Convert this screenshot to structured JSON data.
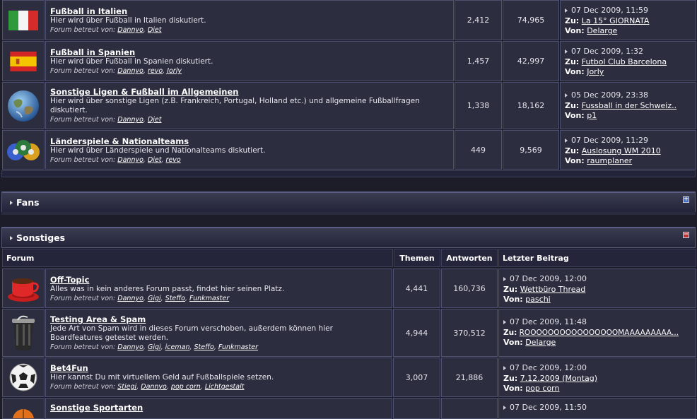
{
  "section_top": {
    "forums": [
      {
        "title": "Fußball in Italien",
        "description": "Hier wird über Fußball in Italien diskutiert.",
        "mods_label": "Forum betreut von:",
        "mods": [
          "Dannyo",
          "Djet"
        ],
        "topics": "2,412",
        "posts": "74,965",
        "last_date": "07 Dec 2009, 11:59",
        "last_to_label": "Zu:",
        "last_thread": "La 15° GIORNATA",
        "last_by_label": "Von:",
        "last_user": "Delarge",
        "icon": "flag-italy-icon"
      },
      {
        "title": "Fußball in Spanien",
        "description": "Hier wird über Fußball in Spanien diskutiert.",
        "mods_label": "Forum betreut von:",
        "mods": [
          "Dannyo",
          "revo",
          "Jorly"
        ],
        "topics": "1,457",
        "posts": "42,997",
        "last_date": "07 Dec 2009, 1:32",
        "last_to_label": "Zu:",
        "last_thread": "Futbol Club Barcelona",
        "last_by_label": "Von:",
        "last_user": "Jorly",
        "icon": "flag-spain-icon"
      },
      {
        "title": "Sonstige Ligen & Fußball im Allgemeinen",
        "description": "Hier wird über sonstige Ligen (z.B. Frankreich, Portugal, Holland etc.) und allgemeine Fußballfragen diskutiert.",
        "mods_label": "Forum betreut von:",
        "mods": [
          "Dannyo",
          "Djet"
        ],
        "topics": "1,338",
        "posts": "18,162",
        "last_date": "05 Dec 2009, 23:38",
        "last_to_label": "Zu:",
        "last_thread": "Fussball in der Schweiz..",
        "last_by_label": "Von:",
        "last_user": "p1",
        "icon": "globe-icon"
      },
      {
        "title": "Länderspiele & Nationalteams",
        "description": "Hier wird über Länderspiele und Nationalteams diskutiert.",
        "mods_label": "Forum betreut von:",
        "mods": [
          "Dannyo",
          "Djet",
          "revo"
        ],
        "topics": "449",
        "posts": "9,569",
        "last_date": "07 Dec 2009, 11:29",
        "last_to_label": "Zu:",
        "last_thread": "Auslosung WM 2010",
        "last_by_label": "Von:",
        "last_user": "raumplaner",
        "icon": "soccer-balls-icon"
      }
    ]
  },
  "category_fans": {
    "label": "Fans",
    "toggle": "+"
  },
  "category_sonstiges": {
    "label": "Sonstiges",
    "toggle": "−",
    "columns": {
      "forum": "Forum",
      "topics": "Themen",
      "posts": "Antworten",
      "last": "Letzter Beitrag"
    },
    "forums": [
      {
        "title": "Off-Topic",
        "description": "Alles was in kein anderes Forum passt, findet hier seinen Platz.",
        "mods_label": "Forum betreut von:",
        "mods": [
          "Dannyo",
          "Gigi",
          "Steffo",
          "Funkmaster"
        ],
        "topics": "4,441",
        "posts": "160,736",
        "last_date": "07 Dec 2009, 12:00",
        "last_to_label": "Zu:",
        "last_thread": "Wettbüro Thread",
        "last_by_label": "Von:",
        "last_user": "paschi",
        "icon": "coffee-cup-icon"
      },
      {
        "title": "Testing Area & Spam",
        "description": "Jede Art von Spam wird in dieses Forum verschoben, außerdem können hier Boardfeatures getestet werden.",
        "mods_label": "Forum betreut von:",
        "mods": [
          "Dannyo",
          "Gigi",
          "iceman",
          "Steffo",
          "Funkmaster"
        ],
        "topics": "4,944",
        "posts": "370,512",
        "last_date": "07 Dec 2009, 11:48",
        "last_to_label": "Zu:",
        "last_thread": "ROOOOOOOOOOOOOOOOMAAAAAAAAA...",
        "last_by_label": "Von:",
        "last_user": "Delarge",
        "icon": "trash-can-icon"
      },
      {
        "title": "Bet4Fun",
        "description": "Hier kannst Du mit virtuellem Geld auf Fußballspiele setzen.",
        "mods_label": "Forum betreut von:",
        "mods": [
          "Stiegi",
          "Dannyo",
          "pop corn",
          "Lichtgestalt"
        ],
        "topics": "3,007",
        "posts": "21,886",
        "last_date": "07 Dec 2009, 12:00",
        "last_to_label": "Zu:",
        "last_thread": "7.12.2009 (Montag)",
        "last_by_label": "Von:",
        "last_user": "pop corn",
        "icon": "soccer-ball-icon"
      },
      {
        "title": "Sonstige Sportarten",
        "last_date": "07 Dec 2009, 11:50",
        "icon": "basketball-icon"
      }
    ]
  }
}
